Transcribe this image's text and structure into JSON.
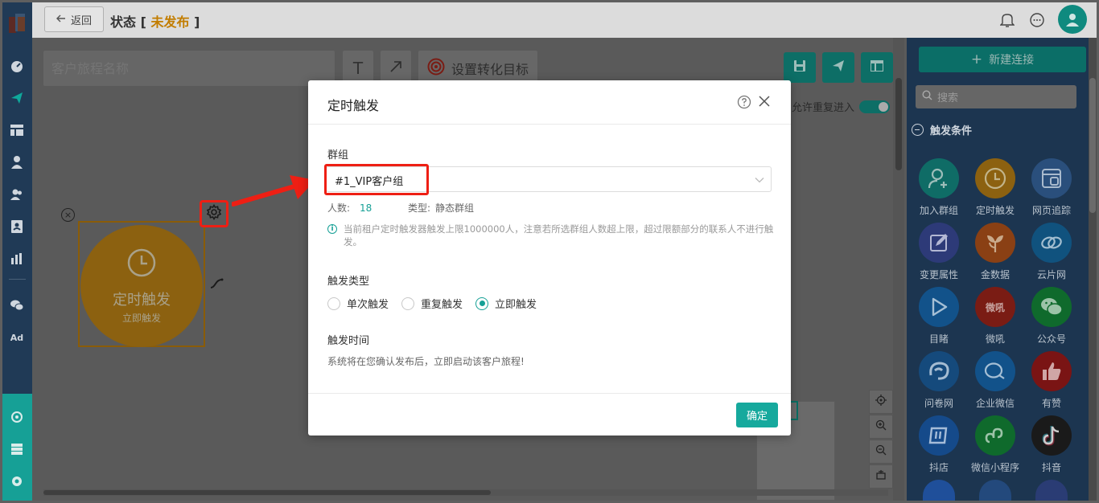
{
  "topbar": {
    "back_label": "返回",
    "title": "状态",
    "status_open": "[",
    "status": "未发布",
    "status_close": "]"
  },
  "canvas": {
    "name_placeholder": "客户旅程名称",
    "text_tool": "T",
    "goal_label": "设置转化目标",
    "allow_repeat_label": "允许重复进入",
    "allow_repeat_on": true,
    "node": {
      "title": "定时触发",
      "subtitle": "立即触发",
      "close": "×"
    }
  },
  "modal": {
    "title": "定时触发",
    "group_label": "群组",
    "group_value": "#1_VIP客户组",
    "count_label": "人数:",
    "count_value": "18",
    "type_label": "类型:",
    "type_value": "静态群组",
    "info_icon": "i",
    "info_text": "当前租户定时触发器触发上限1000000人，注意若所选群组人数超上限，超过限额部分的联系人不进行触发。",
    "trigger_type_label": "触发类型",
    "trigger_types": [
      {
        "label": "单次触发",
        "selected": false
      },
      {
        "label": "重复触发",
        "selected": false
      },
      {
        "label": "立即触发",
        "selected": true
      }
    ],
    "trigger_time_label": "触发时间",
    "trigger_time_desc": "系统将在您确认发布后，立即启动该客户旅程!",
    "ok_label": "确定"
  },
  "panel": {
    "new_connection": "新建连接",
    "search_placeholder": "搜索",
    "section_title": "触发条件",
    "items": [
      {
        "label": "加入群组",
        "icon": "add-user-icon",
        "color": "#0f6c66"
      },
      {
        "label": "定时触发",
        "icon": "clock-icon",
        "color": "#8c6110"
      },
      {
        "label": "网页追踪",
        "icon": "webpage-icon",
        "color": "#2a4f7c"
      },
      {
        "label": "变更属性",
        "icon": "edit-icon",
        "color": "#2d3a78"
      },
      {
        "label": "金数据",
        "icon": "leaf-icon",
        "color": "#8a4014"
      },
      {
        "label": "云片网",
        "icon": "cloud-icon",
        "color": "#10527e"
      },
      {
        "label": "目睹",
        "icon": "play-icon",
        "color": "#12528a"
      },
      {
        "label": "微吼",
        "icon": "weihou-icon",
        "color": "#7a1c14",
        "glyph": "微吼"
      },
      {
        "label": "公众号",
        "icon": "wechat-icon",
        "color": "#0f6a2c"
      },
      {
        "label": "问卷网",
        "icon": "survey-icon",
        "color": "#154a7c"
      },
      {
        "label": "企业微信",
        "icon": "work-wechat-icon",
        "color": "#12528a"
      },
      {
        "label": "有赞",
        "icon": "thumb-up-icon",
        "color": "#7a1414"
      },
      {
        "label": "抖店",
        "icon": "doudian-icon",
        "color": "#154a8a"
      },
      {
        "label": "微信小程序",
        "icon": "miniprogram-icon",
        "color": "#0f6a2c"
      },
      {
        "label": "抖音",
        "icon": "tiktok-icon",
        "color": "#1a1a1a"
      }
    ]
  },
  "colors": {
    "teal": "#16a096",
    "status": "#c27d00",
    "highlight": "#ee1f14",
    "rail": "#203a56"
  }
}
